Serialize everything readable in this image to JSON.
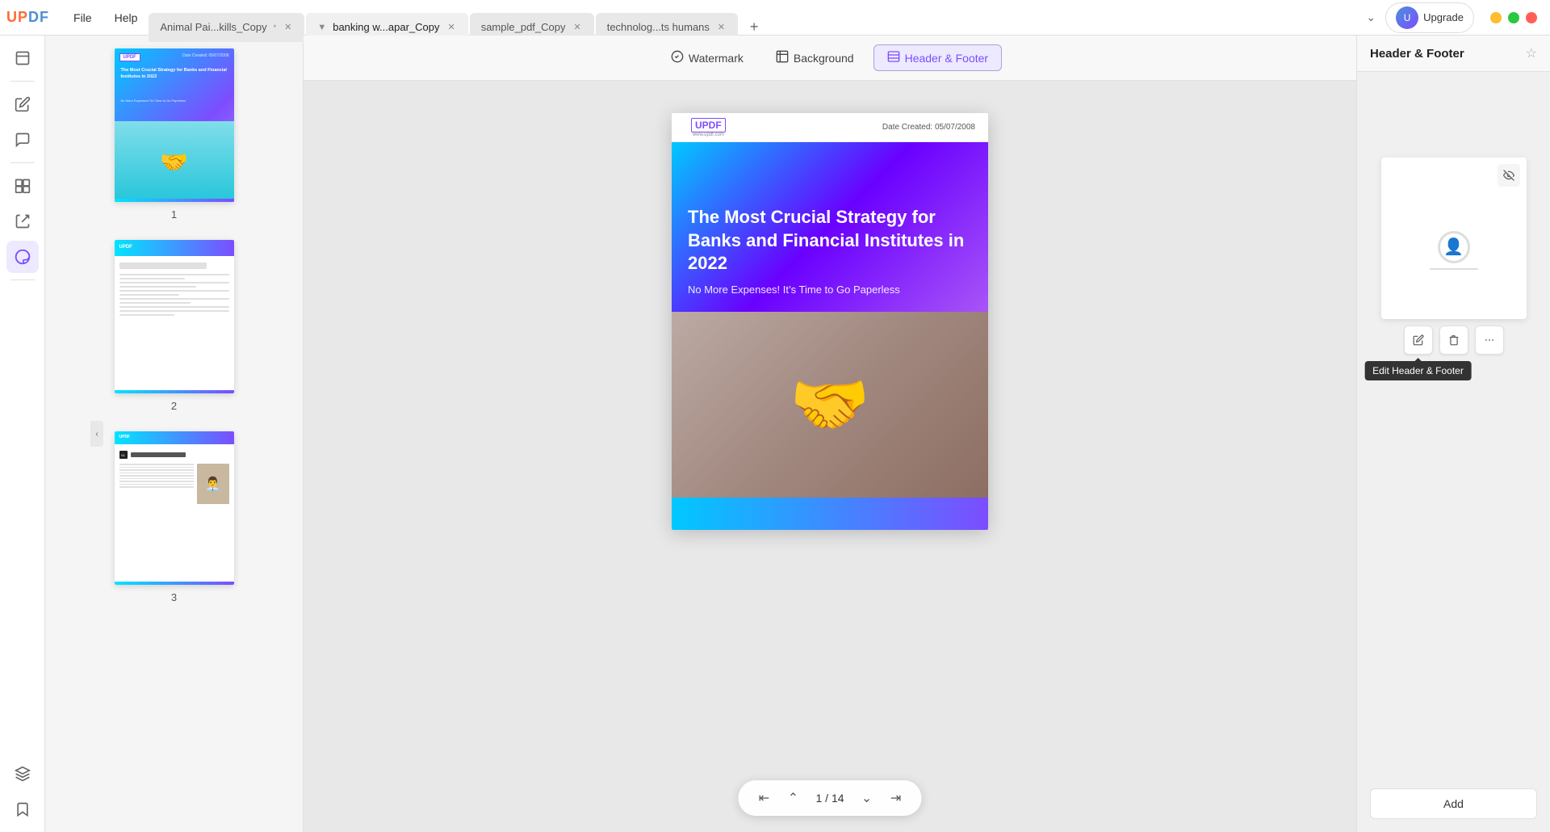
{
  "app": {
    "logo": "UPDF",
    "logo_up": "UP",
    "logo_df": "DF"
  },
  "menu": {
    "file": "File",
    "help": "Help"
  },
  "tabs": [
    {
      "id": "tab1",
      "label": "Animal Pai...kills_Copy",
      "active": false,
      "modified": true
    },
    {
      "id": "tab2",
      "label": "banking w...apar_Copy",
      "active": true,
      "modified": false
    },
    {
      "id": "tab3",
      "label": "sample_pdf_Copy",
      "active": false,
      "modified": false
    },
    {
      "id": "tab4",
      "label": "technolog...ts humans",
      "active": false,
      "modified": false
    }
  ],
  "upgrade": {
    "label": "Upgrade"
  },
  "toolbar": {
    "watermark_label": "Watermark",
    "background_label": "Background",
    "header_footer_label": "Header & Footer"
  },
  "thumbnail_pages": [
    {
      "number": "1"
    },
    {
      "number": "2"
    },
    {
      "number": "3"
    }
  ],
  "pdf": {
    "logo": "UPDF",
    "logo_sub": "www.updf.com",
    "date_label": "Date Created: 05/07/2008",
    "title": "The Most Crucial Strategy for Banks and Financial Institutes in 2022",
    "subtitle": "No More Expenses! It’s Time to Go Paperless"
  },
  "pagination": {
    "current": "1",
    "total": "14",
    "display": "1 / 14"
  },
  "right_panel": {
    "title": "Header & Footer",
    "add_label": "Add"
  },
  "tooltip": {
    "edit_label": "Edit Header & Footer"
  },
  "actions": {
    "edit_icon": "✏️",
    "delete_icon": "🗑",
    "more_icon": "•••"
  }
}
